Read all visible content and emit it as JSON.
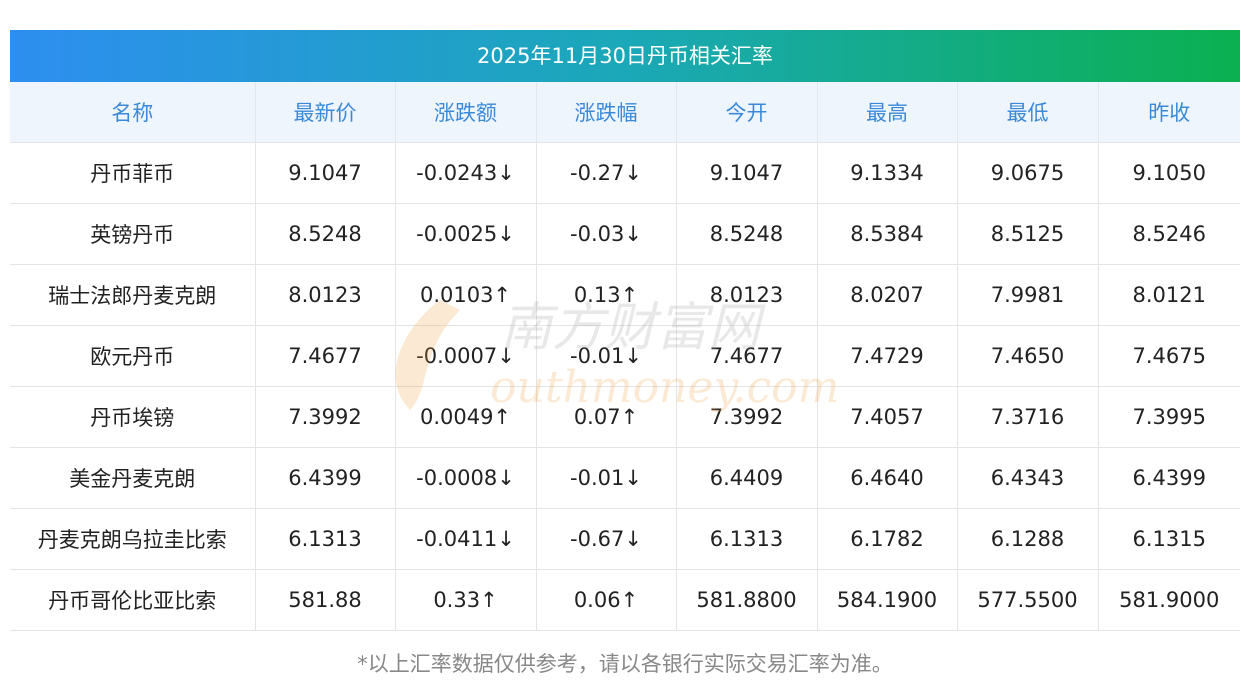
{
  "title": "2025年11月30日丹币相关汇率",
  "columns": [
    "名称",
    "最新价",
    "涨跌额",
    "涨跌幅",
    "今开",
    "最高",
    "最低",
    "昨收"
  ],
  "rows": [
    {
      "name": "丹币菲币",
      "latest": "9.1047",
      "change": "-0.0243↓",
      "pct": "-0.27↓",
      "open": "9.1047",
      "high": "9.1334",
      "low": "9.0675",
      "prev": "9.1050",
      "dir": "down"
    },
    {
      "name": "英镑丹币",
      "latest": "8.5248",
      "change": "-0.0025↓",
      "pct": "-0.03↓",
      "open": "8.5248",
      "high": "8.5384",
      "low": "8.5125",
      "prev": "8.5246",
      "dir": "down"
    },
    {
      "name": "瑞士法郎丹麦克朗",
      "latest": "8.0123",
      "change": "0.0103↑",
      "pct": "0.13↑",
      "open": "8.0123",
      "high": "8.0207",
      "low": "7.9981",
      "prev": "8.0121",
      "dir": "up"
    },
    {
      "name": "欧元丹币",
      "latest": "7.4677",
      "change": "-0.0007↓",
      "pct": "-0.01↓",
      "open": "7.4677",
      "high": "7.4729",
      "low": "7.4650",
      "prev": "7.4675",
      "dir": "down"
    },
    {
      "name": "丹币埃镑",
      "latest": "7.3992",
      "change": "0.0049↑",
      "pct": "0.07↑",
      "open": "7.3992",
      "high": "7.4057",
      "low": "7.3716",
      "prev": "7.3995",
      "dir": "up"
    },
    {
      "name": "美金丹麦克朗",
      "latest": "6.4399",
      "change": "-0.0008↓",
      "pct": "-0.01↓",
      "open": "6.4409",
      "high": "6.4640",
      "low": "6.4343",
      "prev": "6.4399",
      "dir": "down"
    },
    {
      "name": "丹麦克朗乌拉圭比索",
      "latest": "6.1313",
      "change": "-0.0411↓",
      "pct": "-0.67↓",
      "open": "6.1313",
      "high": "6.1782",
      "low": "6.1288",
      "prev": "6.1315",
      "dir": "down"
    },
    {
      "name": "丹币哥伦比亚比索",
      "latest": "581.88",
      "change": "0.33↑",
      "pct": "0.06↑",
      "open": "581.8800",
      "high": "584.1900",
      "low": "577.5500",
      "prev": "581.9000",
      "dir": "up"
    }
  ],
  "footnote": "*以上汇率数据仅供参考，请以各银行实际交易汇率为准。",
  "watermark": {
    "cn": "南方财富网",
    "en": "outhmoney.com"
  },
  "colors": {
    "up": "#e31c1c",
    "down": "#1f8a1f",
    "header_text": "#3b8ad9",
    "title_gradient_start": "#2d8ef0",
    "title_gradient_end": "#0bb050"
  }
}
